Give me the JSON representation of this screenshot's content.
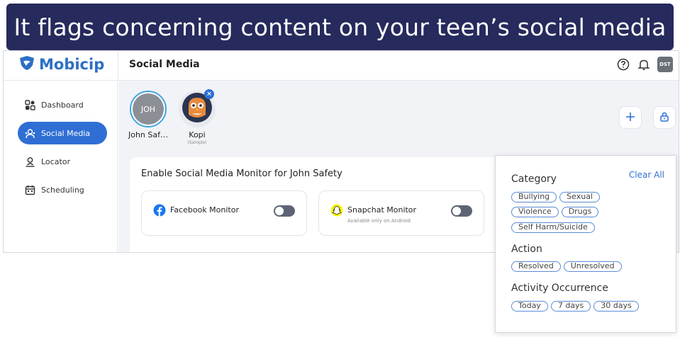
{
  "banner": {
    "text": "It flags concerning content on your teen’s social media"
  },
  "app": {
    "logo_text": "Mobicip",
    "page_title": "Social Media",
    "avatar_initials": "DST"
  },
  "sidebar": {
    "items": [
      {
        "label": "Dashboard",
        "icon": "dashboard-icon",
        "active": false
      },
      {
        "label": "Social Media",
        "icon": "social-media-icon",
        "active": true
      },
      {
        "label": "Locator",
        "icon": "locator-icon",
        "active": false
      },
      {
        "label": "Scheduling",
        "icon": "calendar-icon",
        "active": false
      }
    ]
  },
  "children": [
    {
      "initials": "JOH",
      "name": "John Saf…",
      "sub": ""
    },
    {
      "initials": "",
      "name": "Kopi",
      "sub": "(Sample)"
    }
  ],
  "card": {
    "title": "Enable Social Media Monitor for John Safety",
    "monitors": [
      {
        "label": "Facebook Monitor",
        "sub": "",
        "enabled": false
      },
      {
        "label": "Snapchat Monitor",
        "sub": "Available only on Android",
        "enabled": false
      }
    ]
  },
  "filters": {
    "clear_all": "Clear All",
    "category_title": "Category",
    "category_chips": [
      "Bullying",
      "Sexual",
      "Violence",
      "Drugs",
      "Self Harm/Suicide"
    ],
    "action_title": "Action",
    "action_chips": [
      "Resolved",
      "Unresolved"
    ],
    "occurrence_title": "Activity Occurrence",
    "occurrence_chips": [
      "Today",
      "7 days",
      "30 days"
    ]
  },
  "colors": {
    "banner": "#262a5c",
    "accent": "#2f6fd4",
    "toggle_off": "#5d6575"
  }
}
